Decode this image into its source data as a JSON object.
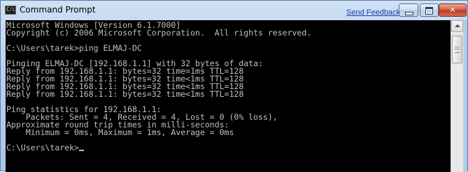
{
  "window": {
    "title": "Command Prompt",
    "icon": "cmd-icon",
    "icon_text": "C:\\.",
    "send_feedback": "Send Feedback",
    "controls": {
      "minimize": "minimize-icon",
      "maximize": "maximize-icon",
      "close": "close-icon",
      "close_glyph": "✕"
    }
  },
  "console": {
    "lines": [
      "Microsoft Windows [Version 6.1.7000]",
      "Copyright (c) 2006 Microsoft Corporation.  All rights reserved.",
      "",
      "C:\\Users\\tarek>ping ELMAJ-DC",
      "",
      "Pinging ELMAJ-DC [192.168.1.1] with 32 bytes of data:",
      "Reply from 192.168.1.1: bytes=32 time=1ms TTL=128",
      "Reply from 192.168.1.1: bytes=32 time<1ms TTL=128",
      "Reply from 192.168.1.1: bytes=32 time<1ms TTL=128",
      "Reply from 192.168.1.1: bytes=32 time<1ms TTL=128",
      "",
      "Ping statistics for 192.168.1.1:",
      "    Packets: Sent = 4, Received = 4, Lost = 0 (0% loss),",
      "Approximate round trip times in milli-seconds:",
      "    Minimum = 0ms, Maximum = 1ms, Average = 0ms",
      "",
      "C:\\Users\\tarek>"
    ],
    "colors": {
      "background": "#000000",
      "foreground": "#c0c0c0"
    }
  }
}
